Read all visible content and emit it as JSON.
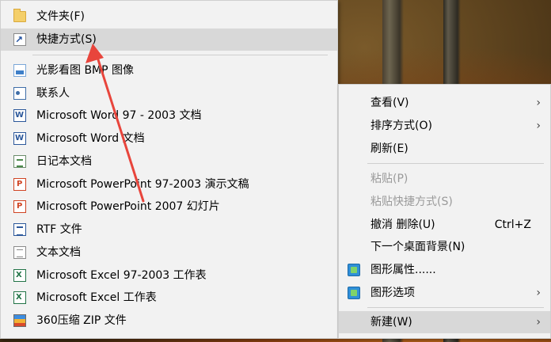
{
  "submenu": {
    "items": [
      {
        "label": "文件夹(F)",
        "icon": "folder-icon"
      },
      {
        "label": "快捷方式(S)",
        "icon": "shortcut-icon"
      },
      {
        "label": "光影看图 BMP 图像",
        "icon": "bmp-image-icon"
      },
      {
        "label": "联系人",
        "icon": "contact-icon"
      },
      {
        "label": "Microsoft Word 97 - 2003 文档",
        "icon": "word-doc-icon"
      },
      {
        "label": "Microsoft Word 文档",
        "icon": "word-doc-icon"
      },
      {
        "label": "日记本文档",
        "icon": "journal-icon"
      },
      {
        "label": "Microsoft PowerPoint 97-2003 演示文稿",
        "icon": "powerpoint-icon"
      },
      {
        "label": "Microsoft PowerPoint 2007 幻灯片",
        "icon": "powerpoint-icon"
      },
      {
        "label": "RTF 文件",
        "icon": "rtf-file-icon"
      },
      {
        "label": "文本文档",
        "icon": "text-document-icon"
      },
      {
        "label": "Microsoft Excel 97-2003 工作表",
        "icon": "excel-icon"
      },
      {
        "label": "Microsoft Excel 工作表",
        "icon": "excel-icon"
      },
      {
        "label": "360压缩 ZIP 文件",
        "icon": "zip-archive-icon"
      }
    ],
    "highlighted": "快捷方式(S)"
  },
  "context_menu": {
    "items": [
      {
        "label": "查看(V)",
        "submenu_arrow": "›"
      },
      {
        "label": "排序方式(O)",
        "submenu_arrow": "›"
      },
      {
        "label": "刷新(E)"
      },
      {
        "label": "粘贴(P)",
        "disabled": true
      },
      {
        "label": "粘贴快捷方式(S)",
        "disabled": true
      },
      {
        "label": "撤消 删除(U)",
        "accelerator": "Ctrl+Z"
      },
      {
        "label": "下一个桌面背景(N)"
      },
      {
        "label": "图形属性......",
        "icon": "graphics-properties-icon"
      },
      {
        "label": "图形选项",
        "icon": "graphics-options-icon",
        "submenu_arrow": "›"
      },
      {
        "label": "新建(W)",
        "submenu_arrow": "›",
        "highlighted": true
      }
    ]
  },
  "annotation": {
    "color": "#e8453c",
    "icon": "red-pointer-arrow"
  },
  "colors": {
    "menu_bg": "#f2f2f2",
    "highlight": "#d8d8d8",
    "disabled_text": "#9a9a9a"
  }
}
